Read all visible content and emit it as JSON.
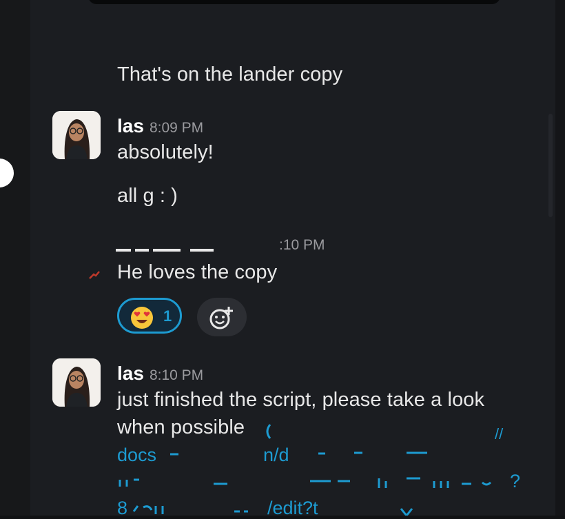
{
  "messages": [
    {
      "text": "That's on the lander copy"
    },
    {
      "author": "las",
      "time": "8:09 PM",
      "lines": [
        "absolutely!",
        "all g : )"
      ]
    },
    {
      "time_partial": ":10 PM",
      "text": "He loves the copy",
      "reaction": {
        "emoji": "heart-eyes-emoji",
        "count": "1"
      },
      "add_reaction": "add-reaction-icon"
    },
    {
      "author": "las",
      "time": "8:10 PM",
      "lines": [
        "just finished the script, please take a look",
        "when possible"
      ],
      "link_fragments": [
        "docs",
        "n/d",
        "//",
        "?",
        "8",
        "/edit?t"
      ]
    }
  ],
  "colors": {
    "background": "#1b1d21",
    "text": "#e8e8e8",
    "timestamp": "#9a9a9e",
    "link": "#1d9bd1",
    "reaction_border": "#1d9bd1"
  }
}
